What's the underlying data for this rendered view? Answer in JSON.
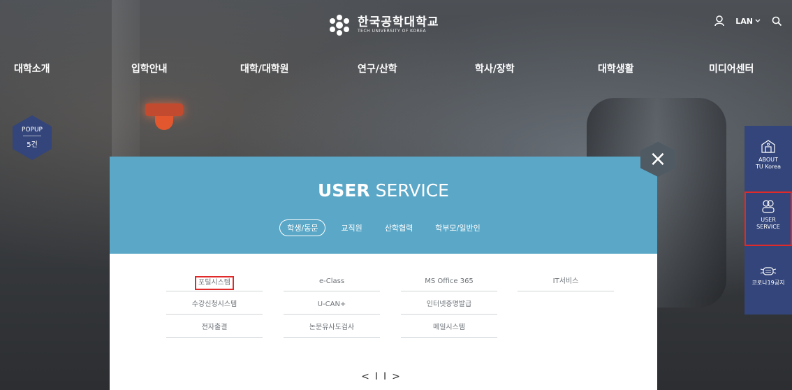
{
  "header": {
    "logo_kr": "한국공학대학교",
    "logo_en": "TECH UNIVERSITY OF KOREA",
    "lang_label": "LAN",
    "user_icon": "user-icon",
    "search_icon": "search-icon"
  },
  "gnb": [
    "대학소개",
    "입학안내",
    "대학/대학원",
    "연구/산학",
    "학사/장학",
    "대학생활",
    "미디어센터"
  ],
  "popup": {
    "label": "POPUP",
    "count": "5건"
  },
  "quick_menu": {
    "items": [
      {
        "line1": "ABOUT",
        "line2": "TU Korea",
        "icon": "building-icon"
      },
      {
        "line1": "USER",
        "line2": "SERVICE",
        "icon": "users-icon",
        "active": true
      },
      {
        "line1": "코로나19공지",
        "line2": "",
        "icon": "mask-icon"
      }
    ]
  },
  "modal": {
    "title_bold": "USER",
    "title_rest": " SERVICE",
    "tabs": [
      "학생/동문",
      "교직원",
      "산학협력",
      "학부모/일반인"
    ],
    "active_tab": "학생/동문",
    "services": [
      [
        "포털시스템",
        "e-Class",
        "MS Office 365",
        "IT서비스"
      ],
      [
        "수강신청시스템",
        "U-CAN+",
        "인터넷증명발급"
      ],
      [
        "전자출결",
        "논문유사도검사",
        "메일시스템"
      ]
    ],
    "pager": {
      "prev": "<",
      "pause": "II",
      "next": ">"
    },
    "close": "×"
  },
  "colors": {
    "modal_header": "#5aa7c7",
    "quick_menu": "#33457a",
    "highlight": "#e02a2a"
  }
}
